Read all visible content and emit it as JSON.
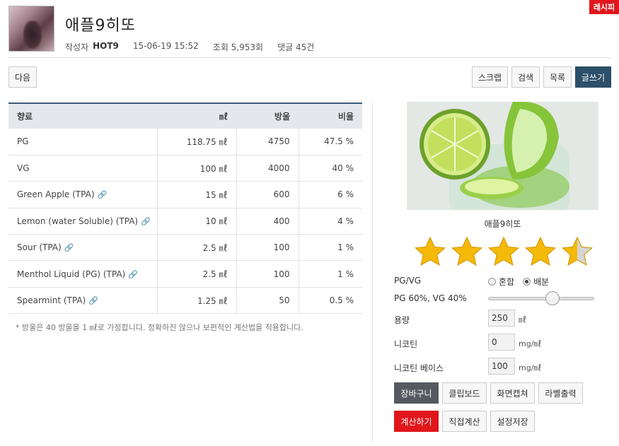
{
  "badge": "레시피",
  "header": {
    "title": "애플9히또",
    "author_label": "작성자",
    "author": "HOT9",
    "date": "15-06-19 15:52",
    "views": "조회 5,953회",
    "comments": "댓글 45건"
  },
  "toolbar": {
    "next": "다음",
    "scrap": "스크랩",
    "search": "검색",
    "list": "목록",
    "write": "글쓰기"
  },
  "table": {
    "headers": [
      "향료",
      "㎖",
      "방울",
      "비율"
    ],
    "rows": [
      {
        "name": "PG",
        "ml": "118.75 ㎖",
        "drops": "4750",
        "ratio": "47.5 %",
        "link": false
      },
      {
        "name": "VG",
        "ml": "100 ㎖",
        "drops": "4000",
        "ratio": "40 %",
        "link": false
      },
      {
        "name": "Green Apple (TPA)",
        "ml": "15 ㎖",
        "drops": "600",
        "ratio": "6 %",
        "link": true
      },
      {
        "name": "Lemon (water Soluble) (TPA)",
        "ml": "10 ㎖",
        "drops": "400",
        "ratio": "4 %",
        "link": true
      },
      {
        "name": "Sour (TPA)",
        "ml": "2.5 ㎖",
        "drops": "100",
        "ratio": "1 %",
        "link": true
      },
      {
        "name": "Menthol Liquid (PG) (TPA)",
        "ml": "2.5 ㎖",
        "drops": "100",
        "ratio": "1 %",
        "link": true
      },
      {
        "name": "Spearmint (TPA)",
        "ml": "1.25 ㎖",
        "drops": "50",
        "ratio": "0.5 %",
        "link": true
      }
    ],
    "note": "* 방울은 40 방울을 1 ㎖로 가정합니다. 정확하진 않으나 보편적인 계산법을 적용합니다."
  },
  "side": {
    "photo_caption": "애플9히또",
    "rating": 4.5,
    "pgvg_label": "PG/VG",
    "mix_label": "혼합",
    "split_label": "배분",
    "pgvg_value": "PG 60%, VG 40%",
    "pg_fraction": 0.6,
    "volume_label": "용량",
    "volume_value": "250",
    "volume_unit": "㎖",
    "nicotine_label": "니코틴",
    "nicotine_value": "0",
    "nicotine_unit": "mg/㎖",
    "base_label": "니코틴 베이스",
    "base_value": "100",
    "base_unit": "mg/㎖"
  },
  "actions": {
    "cart": "장바구니",
    "clipboard": "클립보드",
    "capture": "화면캡쳐",
    "label_print": "라벨출력",
    "calculate": "계산하기",
    "direct_calc": "직접계산",
    "save_settings": "설정저장"
  },
  "colors": {
    "accent": "#2d4f69",
    "danger": "#e0161b",
    "star": "#f5b90a"
  }
}
